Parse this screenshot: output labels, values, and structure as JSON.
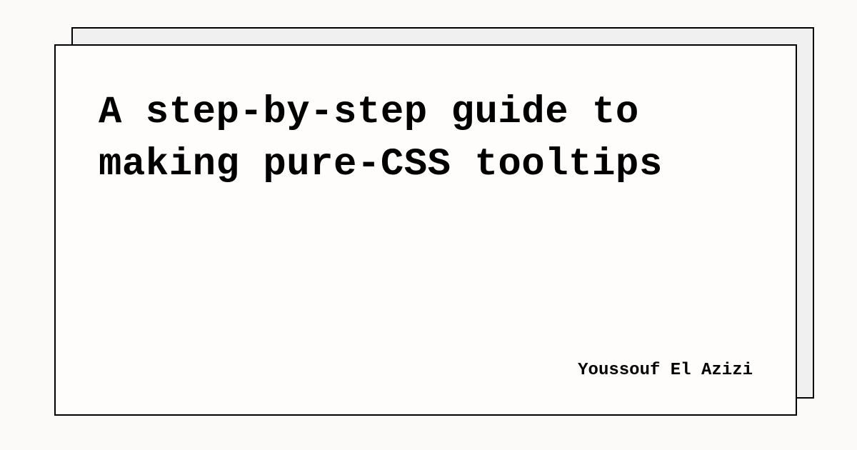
{
  "card": {
    "title": "A step-by-step guide to making pure-CSS tooltips",
    "author": "Youssouf El Azizi"
  }
}
